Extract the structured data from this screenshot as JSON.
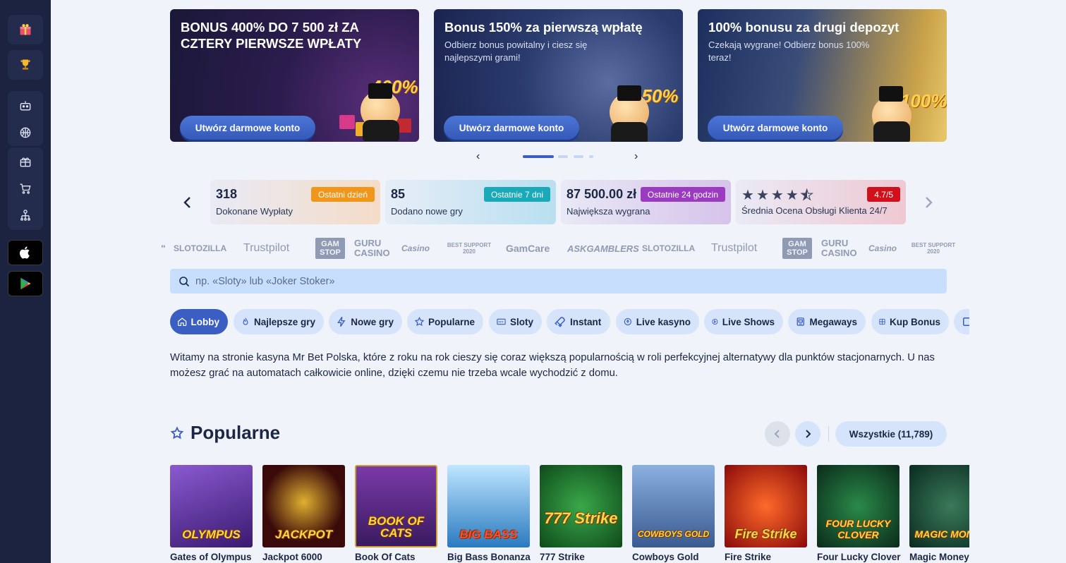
{
  "sidebar": {
    "items": [
      {
        "icon": "gift-box-icon"
      },
      {
        "icon": "trophy-icon"
      },
      {
        "icon": "robot-icon"
      },
      {
        "icon": "basketball-icon"
      },
      {
        "icon": "gift-icon"
      },
      {
        "icon": "cart-icon"
      },
      {
        "icon": "network-icon"
      }
    ],
    "stores": [
      {
        "icon": "apple-icon"
      },
      {
        "icon": "google-play-icon"
      }
    ]
  },
  "banners": [
    {
      "title": "BONUS 400% DO 7 500 zł ZA CZTERY PIERWSZE WPŁATY",
      "subtitle": "",
      "cta": "Utwórz darmowe konto",
      "badge": "400%"
    },
    {
      "title": "Bonus 150% za pierwszą wpłatę",
      "subtitle": "Odbierz bonus powitalny i ciesz się najlepszymi grami!",
      "cta": "Utwórz darmowe konto",
      "badge": "150%"
    },
    {
      "title": "100% bonusu za drugi depozyt",
      "subtitle": "Czekają wygrane! Odbierz bonus 100% teraz!",
      "cta": "Utwórz darmowe konto",
      "badge": "100%"
    }
  ],
  "carousel": {
    "prev": "‹",
    "next": "›",
    "active_index": 0,
    "count": 4
  },
  "stats": [
    {
      "value": "318",
      "label": "Dokonane Wypłaty",
      "badge": "Ostatni dzień",
      "badge_color": "#f0961a"
    },
    {
      "value": "85",
      "label": "Dodano nowe gry",
      "badge": "Ostatnie 7 dni",
      "badge_color": "#1aa9b8"
    },
    {
      "value": "87 500.00 zł",
      "label": "Największa wygrana",
      "badge": "Ostatnie 24 godzin",
      "badge_color": "#9b3cc0"
    },
    {
      "value": "4.5",
      "label": "Średnia Ocena Obsługi Klienta 24/7",
      "badge": "4.7/5",
      "badge_color": "#d2101c"
    }
  ],
  "partners": [
    "SLOTOZILLA",
    "Trustpilot",
    "GAM STOP",
    "GURU CASINO",
    "Casino",
    "BEST SUPPORT 2020",
    "GamCare",
    "ASKGAMBLERS",
    "SLOTOZILLA",
    "Trustpilot",
    "GAM STOP",
    "GURU CASINO",
    "Casino",
    "BEST SUPPORT 2020"
  ],
  "search": {
    "placeholder": "np. «Sloty» lub «Joker Stoker»"
  },
  "categories": [
    {
      "label": "Lobby",
      "icon": "home-icon",
      "active": true
    },
    {
      "label": "Najlepsze gry",
      "icon": "flame-icon"
    },
    {
      "label": "Nowe gry",
      "icon": "lightning-icon"
    },
    {
      "label": "Popularne",
      "icon": "star-icon"
    },
    {
      "label": "Sloty",
      "icon": "slot-777-icon"
    },
    {
      "label": "Instant",
      "icon": "rocket-icon"
    },
    {
      "label": "Live kasyno",
      "icon": "chip-icon"
    },
    {
      "label": "Live Shows",
      "icon": "play-circle-icon"
    },
    {
      "label": "Megaways",
      "icon": "slot-machine-icon"
    },
    {
      "label": "Kup Bonus",
      "icon": "bonus-icon"
    }
  ],
  "intro": "Witamy na stronie kasyna Mr Bet Polska, które z roku na rok cieszy się coraz większą popularnością w roli perfekcyjnej alternatywy dla punktów stacjonarnych. U nas możesz grać na automatach całkowicie online, dzięki czemu nie trzeba wcale wychodzić z domu.",
  "popular": {
    "title": "Popularne",
    "all_label": "Wszystkie (11,789)",
    "games": [
      {
        "name": "Gates of Olympus",
        "logo": "OLYMPUS",
        "bg": "#6a3fa0"
      },
      {
        "name": "Jackpot 6000",
        "logo": "JACKPOT",
        "bg": "#3a0a0a"
      },
      {
        "name": "Book Of Cats",
        "logo": "BOOK OF CATS",
        "bg": "#5a2a80"
      },
      {
        "name": "Big Bass Bonanza",
        "logo": "BIG BASS",
        "bg": "#3a8fd0"
      },
      {
        "name": "777 Strike",
        "logo": "777 Strike",
        "bg": "#1e7a2e"
      },
      {
        "name": "Cowboys Gold",
        "logo": "COWBOYS GOLD",
        "bg": "#4a6aa0"
      },
      {
        "name": "Fire Strike",
        "logo": "Fire Strike",
        "bg": "#b01818"
      },
      {
        "name": "Four Lucky Clover",
        "logo": "FOUR LUCKY CLOVER",
        "bg": "#0f4a2a"
      },
      {
        "name": "Magic Money Maze",
        "logo": "MAGIC MONEY",
        "bg": "#1f4a3a"
      }
    ]
  }
}
